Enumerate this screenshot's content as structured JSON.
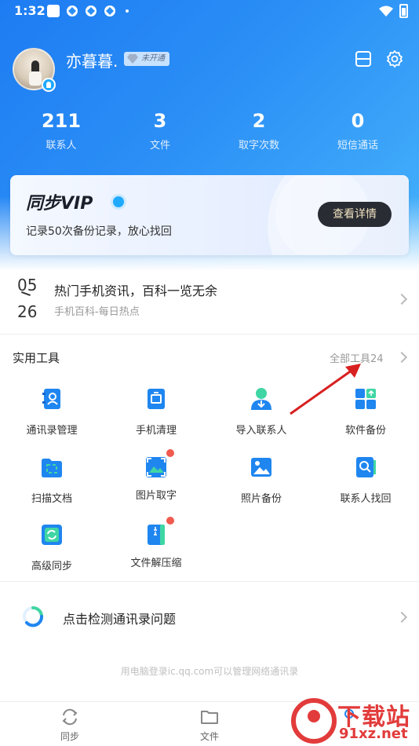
{
  "status_bar": {
    "time": "1:32"
  },
  "profile": {
    "username": "亦暮暮.",
    "vip_tag": "未开通"
  },
  "stats": [
    {
      "value": "211",
      "label": "联系人"
    },
    {
      "value": "3",
      "label": "文件"
    },
    {
      "value": "2",
      "label": "取字次数"
    },
    {
      "value": "0",
      "label": "短信通话"
    }
  ],
  "vip_card": {
    "title": "同步VIP",
    "description": "记录50次备份记录，放心找回",
    "button": "查看详情"
  },
  "news": {
    "date_month": "05",
    "date_day": "26",
    "title": "热门手机资讯，百科一览无余",
    "subtitle": "手机百科-每日热点"
  },
  "tools": {
    "title": "实用工具",
    "all_label": "全部工具24",
    "items": [
      {
        "label": "通讯录管理",
        "icon": "contacts-book-icon",
        "badge": false
      },
      {
        "label": "手机清理",
        "icon": "phone-clean-icon",
        "badge": false
      },
      {
        "label": "导入联系人",
        "icon": "import-contact-icon",
        "badge": false
      },
      {
        "label": "软件备份",
        "icon": "app-backup-icon",
        "badge": false
      },
      {
        "label": "扫描文档",
        "icon": "scan-document-icon",
        "badge": false
      },
      {
        "label": "图片取字",
        "icon": "image-text-icon",
        "badge": true
      },
      {
        "label": "照片备份",
        "icon": "photo-backup-icon",
        "badge": false
      },
      {
        "label": "联系人找回",
        "icon": "contact-recover-icon",
        "badge": false
      },
      {
        "label": "高级同步",
        "icon": "advanced-sync-icon",
        "badge": false
      },
      {
        "label": "文件解压缩",
        "icon": "file-unzip-icon",
        "badge": true
      }
    ]
  },
  "detect": {
    "label": "点击检测通讯录问题"
  },
  "footnote": "用电脑登录ic.qq.com可以管理网络通讯录",
  "bottom_nav": [
    {
      "label": "同步",
      "icon": "sync-icon"
    },
    {
      "label": "文件",
      "icon": "folder-icon"
    }
  ],
  "watermark": {
    "line1": "下载站",
    "line2": "91xz.net"
  },
  "colors": {
    "primary_blue": "#1d7cf2",
    "accent_red": "#f05a4f",
    "vip_button_bg": "#2a2c33",
    "vip_button_text": "#f2e2c0"
  }
}
